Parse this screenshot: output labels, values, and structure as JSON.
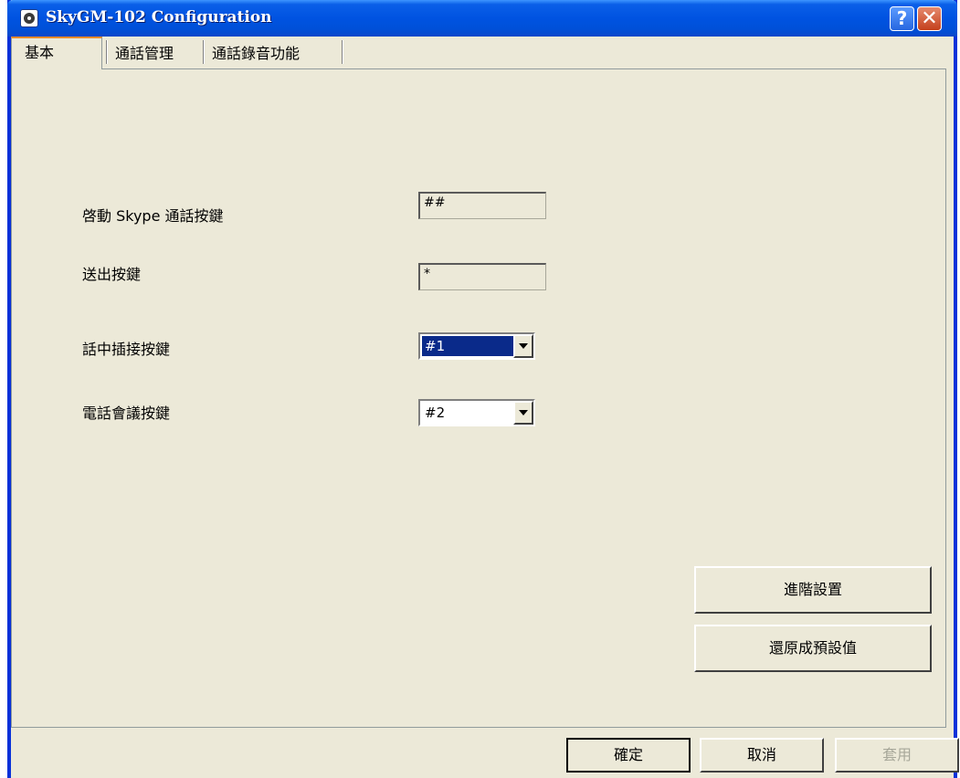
{
  "window": {
    "title": "SkyGM-102 Configuration"
  },
  "titlebar": {
    "help_label": "?",
    "close_label": "✕"
  },
  "tabs": [
    {
      "label": "基本",
      "active": true
    },
    {
      "label": "通話管理",
      "active": false
    },
    {
      "label": "通話錄音功能",
      "active": false
    }
  ],
  "fields": {
    "start_key": {
      "label": "啓動 Skype 通話按鍵",
      "value": "##"
    },
    "send_key": {
      "label": "送出按鍵",
      "value": "*"
    },
    "hold_key": {
      "label": "話中插接按鍵",
      "value": "#1"
    },
    "conference_key": {
      "label": "電話會議按鍵",
      "value": "#2"
    }
  },
  "buttons": {
    "advanced": "進階設置",
    "restore_defaults": "還原成預設值",
    "ok": "確定",
    "cancel": "取消",
    "apply": "套用"
  }
}
